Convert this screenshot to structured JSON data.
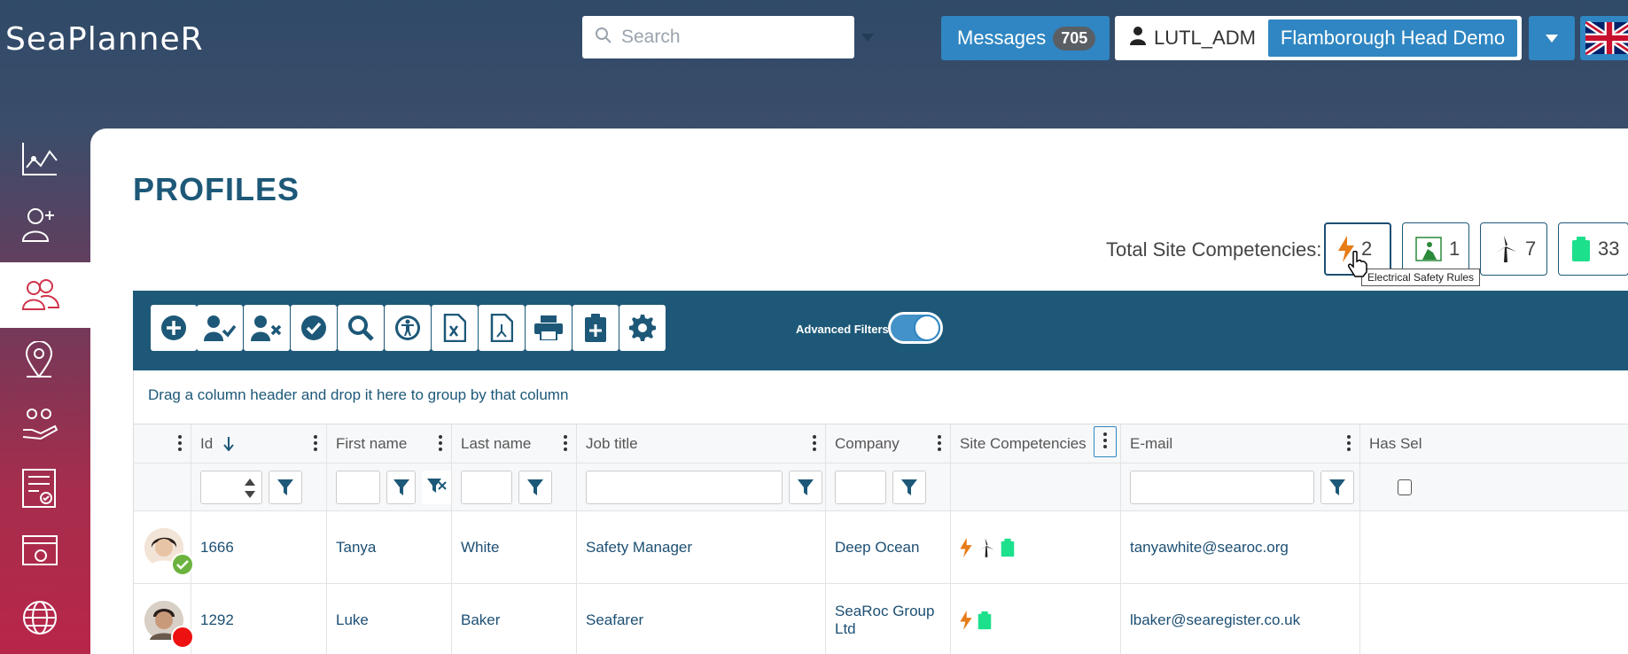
{
  "app": {
    "logo_text": "SeaPlanneR"
  },
  "header": {
    "search_placeholder": "Search",
    "messages_label": "Messages",
    "messages_count": "705",
    "username": "LUTL_ADM",
    "site_name": "Flamborough Head Demo"
  },
  "page": {
    "title": "PROFILES"
  },
  "competencies": {
    "label": "Total Site Competencies:",
    "items": [
      {
        "icon": "lightning-icon",
        "count": "2",
        "color": "#e77b18"
      },
      {
        "icon": "excavation-icon",
        "count": "1",
        "color": "#2a8a3a"
      },
      {
        "icon": "wind-turbine-icon",
        "count": "7",
        "color": "#222222"
      },
      {
        "icon": "clipboard-icon",
        "count": "33",
        "color": "#1de08c"
      }
    ],
    "tooltip": "Electrical Safety Rules"
  },
  "toolbar": {
    "advanced_filters_label": "Advanced Filters"
  },
  "grid": {
    "group_hint": "Drag a column header and drop it here to group by that column",
    "columns": [
      "Id",
      "First name",
      "Last name",
      "Job title",
      "Company",
      "Site Competencies",
      "E-mail",
      "Has Sel"
    ],
    "rows": [
      {
        "id": "1666",
        "first": "Tanya",
        "last": "White",
        "job": "Safety Manager",
        "company": "Deep Ocean",
        "email": "tanyawhite@searoc.org",
        "status_color": "#6bb33e"
      },
      {
        "id": "1292",
        "first": "Luke",
        "last": "Baker",
        "job": "Seafarer",
        "company": "SeaRoc Group Ltd",
        "email": "lbaker@searegister.co.uk",
        "status_color": "#ee1111"
      }
    ]
  },
  "colors": {
    "primary": "#1d5878",
    "accent": "#2f86c2",
    "active_side": "#d0334b"
  }
}
